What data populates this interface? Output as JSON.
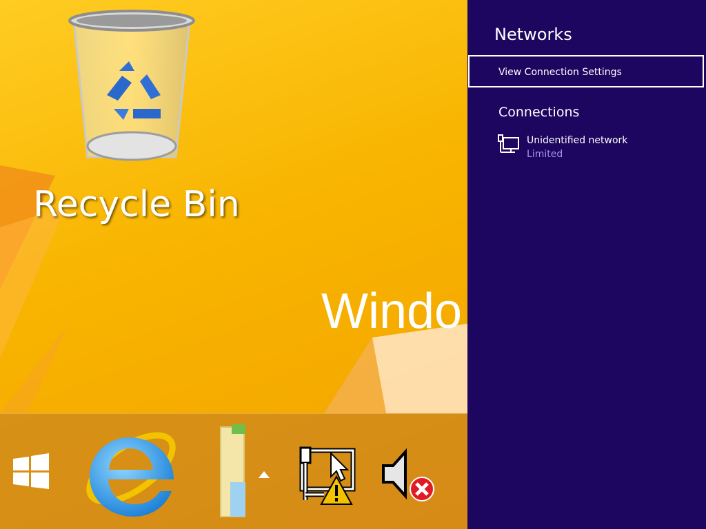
{
  "desktop": {
    "recycle_bin_label": "Recycle Bin",
    "wordmark_text": "Windo",
    "background_color": "#f6b300"
  },
  "taskbar": {
    "icons": [
      "windows-start-icon",
      "internet-explorer-icon",
      "file-explorer-icon",
      "show-hidden-icons-icon",
      "network-warning-icon",
      "speaker-muted-icon"
    ]
  },
  "networks_pane": {
    "title": "Networks",
    "view_connection_settings": "View Connection Settings",
    "connections_heading": "Connections",
    "connections": [
      {
        "name": "Unidentified network",
        "status": "Limited",
        "icon": "wired-network-icon"
      }
    ],
    "background_color": "#1d0660",
    "status_color": "#a98ff0"
  }
}
